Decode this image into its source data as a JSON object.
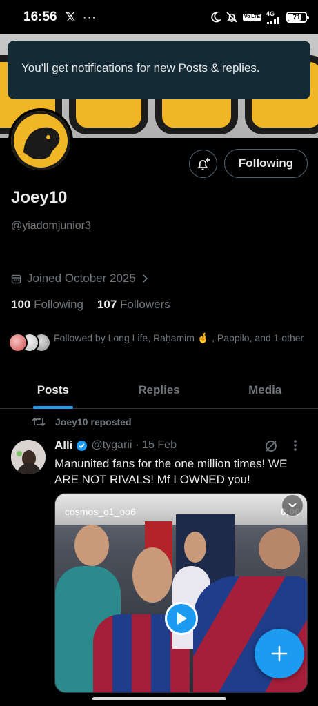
{
  "status_bar": {
    "time": "16:56",
    "x_glyph": "𝕏",
    "dots": "···",
    "network": "4G",
    "vol_tag": "Vo LTE",
    "battery": "71"
  },
  "toast": {
    "message": "You'll get notifications for new Posts & replies."
  },
  "profile": {
    "display_name": "Joey10",
    "handle": "@yiadomjunior3",
    "joined": "Joined October 2025",
    "following_count": "100",
    "following_label": "Following",
    "followers_count": "107",
    "followers_label": "Followers",
    "followed_by": "Followed by Long Life, Raḥamim 🤞 , Pappilo, and 1 other",
    "following_button": "Following"
  },
  "tabs": [
    {
      "label": "Posts"
    },
    {
      "label": "Replies"
    },
    {
      "label": "Media"
    }
  ],
  "post": {
    "repost_label": "Joey10 reposted",
    "author_name": "Alli",
    "author_handle": "@tygarii",
    "date": "· 15 Feb",
    "text": "Manunited fans for the one million times! WE ARE NOT RIVALS! Mf I OWNED you!",
    "media_source": "cosmos_o1_oo6",
    "media_duration": "0:00"
  },
  "colors": {
    "accent": "#1d9bf0",
    "background": "#000000",
    "toast_bg": "#142a35",
    "banner_gold": "#f0b625"
  },
  "icons": [
    "x-logo-icon",
    "moon-icon",
    "bell-off-icon",
    "battery-icon",
    "bell-plus-icon",
    "calendar-icon",
    "chevron-right-icon",
    "repost-icon",
    "verified-badge-icon",
    "grok-icon",
    "more-icon",
    "play-icon",
    "chevron-down-icon",
    "plus-icon"
  ]
}
